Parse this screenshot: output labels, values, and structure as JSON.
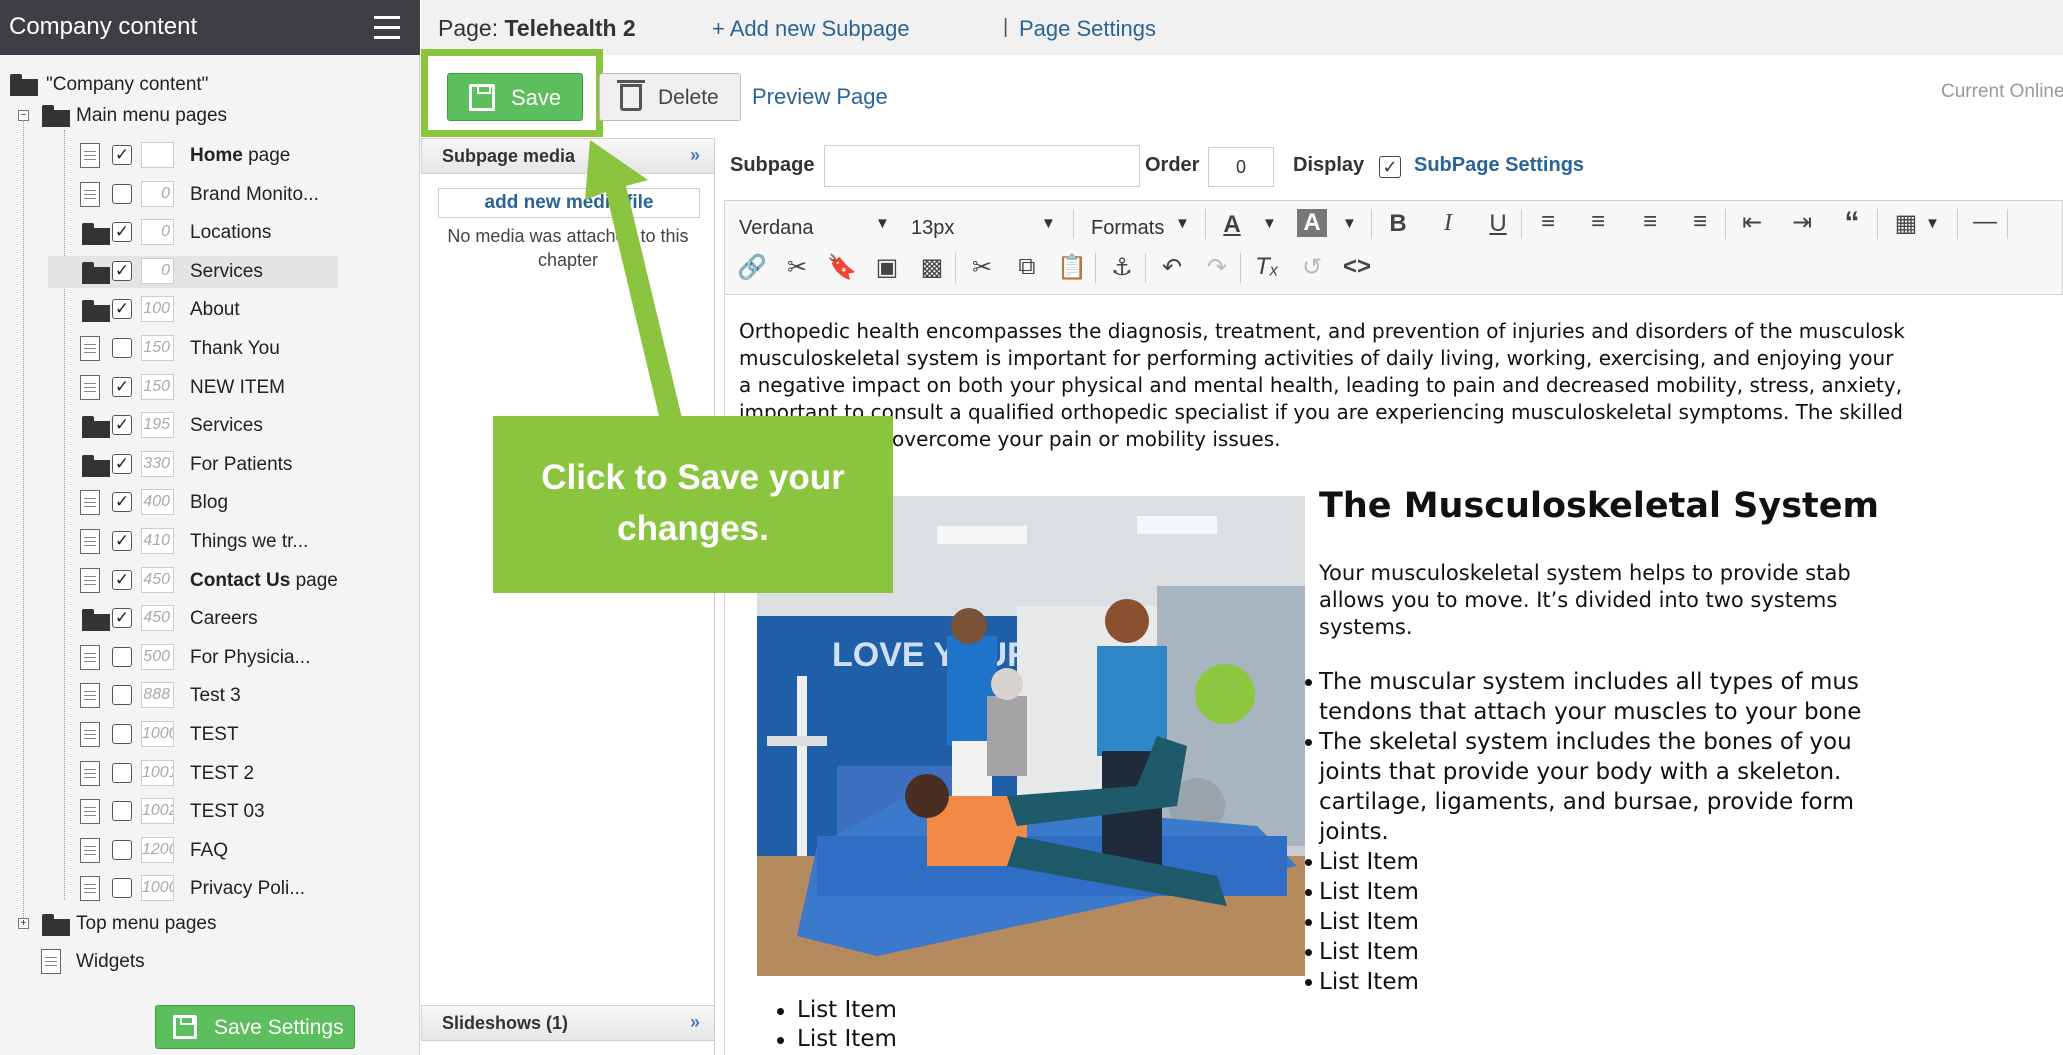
{
  "sidebar": {
    "title": "Company content",
    "root_label": "\"Company content\"",
    "main_group_label": "Main menu pages",
    "items": [
      {
        "label": "Home page",
        "order": "",
        "type": "page",
        "checked": true,
        "bold": "Home",
        "rest": " page"
      },
      {
        "label": "Brand Monito...",
        "order": "0",
        "type": "page",
        "checked": false
      },
      {
        "label": "Locations",
        "order": "0",
        "type": "folder",
        "checked": true
      },
      {
        "label": "Services",
        "order": "0",
        "type": "folder",
        "checked": true
      },
      {
        "label": "About",
        "order": "100",
        "type": "folder",
        "checked": true
      },
      {
        "label": "Thank You",
        "order": "150",
        "type": "page",
        "checked": false
      },
      {
        "label": "NEW ITEM",
        "order": "150",
        "type": "page",
        "checked": true
      },
      {
        "label": "Services",
        "order": "195",
        "type": "folder",
        "checked": true
      },
      {
        "label": "For Patients",
        "order": "330",
        "type": "folder",
        "checked": true
      },
      {
        "label": "Blog",
        "order": "400",
        "type": "page",
        "checked": true
      },
      {
        "label": "Things we tr...",
        "order": "410",
        "type": "page",
        "checked": true
      },
      {
        "label": "Contact Us page",
        "order": "450",
        "type": "page",
        "checked": true,
        "bold": "Contact Us",
        "rest": " page"
      },
      {
        "label": "Careers",
        "order": "450",
        "type": "folder",
        "checked": true
      },
      {
        "label": "For Physicia...",
        "order": "500",
        "type": "page",
        "checked": false
      },
      {
        "label": "Test 3",
        "order": "888",
        "type": "page",
        "checked": false
      },
      {
        "label": "TEST",
        "order": "1000",
        "type": "page",
        "checked": false
      },
      {
        "label": "TEST 2",
        "order": "1001",
        "type": "page",
        "checked": false
      },
      {
        "label": "TEST 03",
        "order": "1002",
        "type": "page",
        "checked": false
      },
      {
        "label": "FAQ",
        "order": "1200",
        "type": "page",
        "checked": false
      },
      {
        "label": "Privacy Poli...",
        "order": "1000",
        "type": "page",
        "checked": false
      }
    ],
    "top_group_label": "Top menu pages",
    "widgets_label": "Widgets",
    "save_settings_label": "Save Settings",
    "selected_item": "Services"
  },
  "topbar": {
    "page_prefix": "Page:",
    "page_name": "Telehealth 2",
    "add_subpage": "+ Add new Subpage",
    "separator": "|",
    "page_settings": "Page Settings"
  },
  "actions": {
    "save_label": "Save",
    "delete_label": "Delete",
    "preview_label": "Preview Page",
    "current_online": "Current Online"
  },
  "media": {
    "header": "Subpage media",
    "add_media": "add new media file",
    "empty_text": "No media was attached to this chapter",
    "slideshows": "Slideshows (1)"
  },
  "subpage": {
    "subpage_label": "Subpage",
    "subpage_value": "",
    "order_label": "Order",
    "order_value": "0",
    "display_label": "Display",
    "display_checked": true,
    "settings_link": "SubPage Settings"
  },
  "editor_toolbar": {
    "font": "Verdana",
    "size": "13px",
    "formats": "Formats"
  },
  "content": {
    "paragraph_lines": [
      "Orthopedic health encompasses the diagnosis, treatment, and prevention of injuries and disorders of the musculosk",
      "musculoskeletal system is important for performing activities of daily living, working, exercising, and enjoying your",
      "a negative impact on both your physical and mental health, leading to pain and decreased mobility, stress, anxiety,",
      "important to consult a qualified orthopedic specialist if you are experiencing musculoskeletal symptoms. The skilled",
      "overcome your pain or mobility issues."
    ],
    "heading": "The Musculoskeletal System",
    "intro_lines": [
      "Your musculoskeletal system helps to provide stab",
      "allows you to move. It’s divided into two systems",
      "systems."
    ],
    "bullets": [
      [
        "The muscular system includes all types of mus",
        "tendons that attach your muscles to your bone"
      ],
      [
        "The skeletal system includes the bones of you",
        "joints that provide your body with a skeleton.",
        "cartilage, ligaments, and bursae, provide form",
        "joints."
      ],
      [
        "List Item"
      ],
      [
        "List Item"
      ],
      [
        "List Item"
      ],
      [
        "List Item"
      ],
      [
        "List Item"
      ]
    ],
    "bottom_bullets": [
      "List Item",
      "List Item"
    ],
    "photo_wall_text": "LOVE YOUR"
  },
  "callout": {
    "line1": "Click to Save your",
    "line2": "changes."
  },
  "colors": {
    "accent_green": "#8bc53f",
    "save_green": "#5cbe5c",
    "link_blue": "#2a6496",
    "sidebar_header": "#3d3f44"
  }
}
